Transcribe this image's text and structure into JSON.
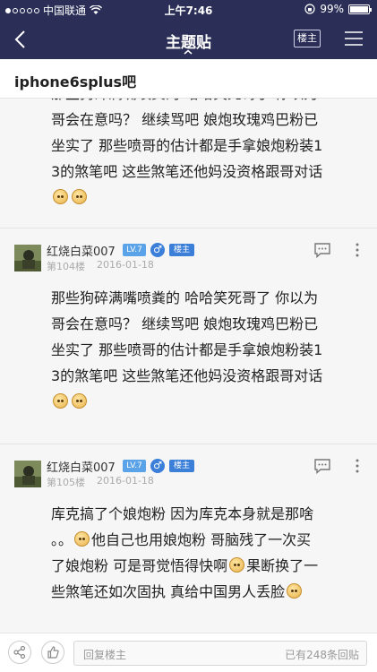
{
  "status": {
    "carrier": "中国联通",
    "time": "上午7:46",
    "battery": "99%",
    "battery_level": 0.99
  },
  "nav": {
    "title": "主题贴",
    "owner_button": "楼主"
  },
  "forum": {
    "name": "iphone6splus吧"
  },
  "posts": [
    {
      "lines": [
        "那些狗碎满嘴喷粪的 哈哈笑死哥了 你以为",
        "哥会在意吗？ 继续骂吧 娘炮玫瑰鸡巴粉已",
        "坐实了 那些喷哥的估计都是手拿娘炮粉装1",
        "3的煞笔吧 这些煞笔还他妈没资格跟哥对话"
      ]
    },
    {
      "username": "红烧白菜007",
      "level": "LV.7",
      "gender": "♂",
      "owner_tag": "楼主",
      "floor": "第104楼",
      "date": "2016-01-18",
      "lines": [
        "那些狗碎满嘴喷粪的 哈哈笑死哥了 你以为",
        "哥会在意吗？ 继续骂吧 娘炮玫瑰鸡巴粉已",
        "坐实了 那些喷哥的估计都是手拿娘炮粉装1",
        "3的煞笔吧 这些煞笔还他妈没资格跟哥对话"
      ]
    },
    {
      "username": "红烧白菜007",
      "level": "LV.7",
      "gender": "♂",
      "owner_tag": "楼主",
      "floor": "第105楼",
      "date": "2016-01-18",
      "line1": "库克搞了个娘炮粉 因为库克本身就是那啥",
      "line2_a": "。。",
      "line2_b": "他自己也用娘炮粉 哥脑残了一次买",
      "line3_a": "了娘炮粉 可是哥觉悟得快啊",
      "line3_b": "果断换了一",
      "line4": "些煞笔还如次固执 真给中国男人丢脸"
    }
  ],
  "bottom": {
    "reply_placeholder": "回复楼主",
    "reply_count": "已有248条回贴"
  },
  "colors": {
    "header": "#2b2f57",
    "level_badge": "#5aa3e8",
    "owner_badge": "#3c7fd9"
  }
}
